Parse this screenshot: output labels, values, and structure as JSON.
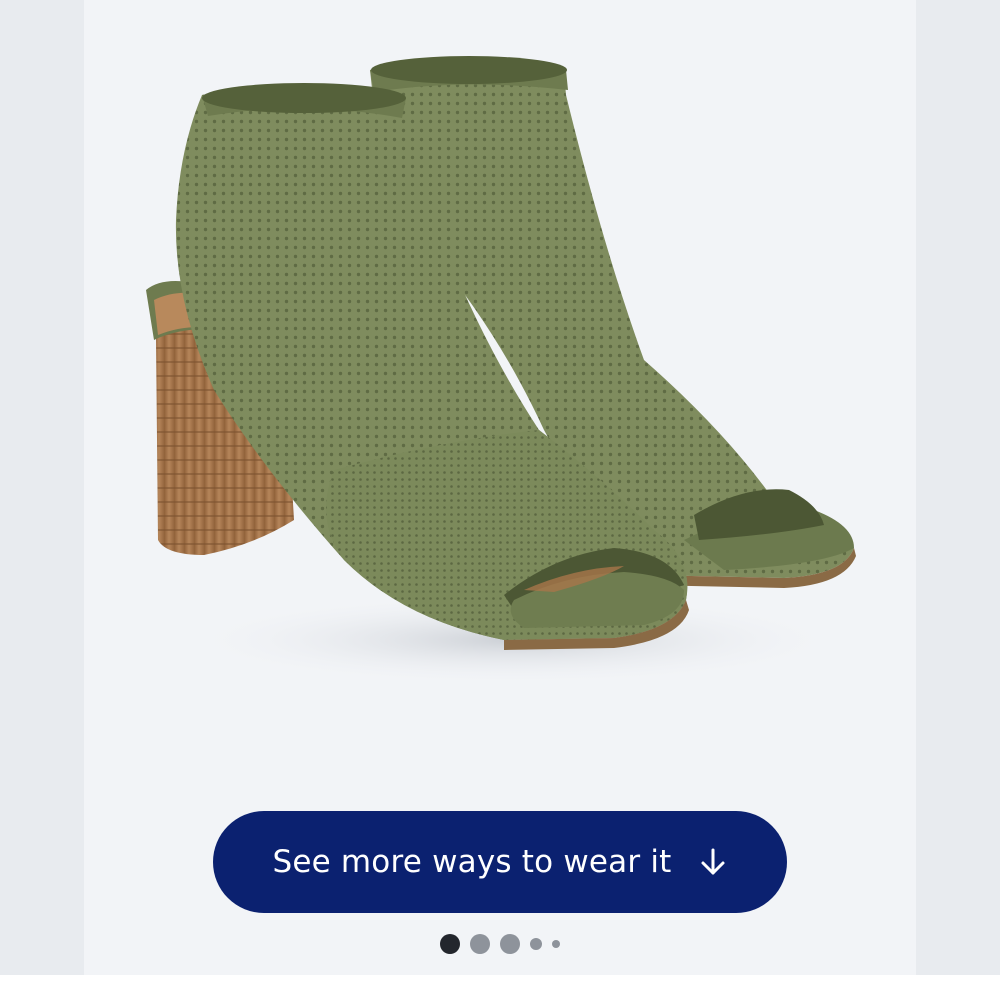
{
  "product": {
    "image_alt": "Olive green knit peep-toe bootie with stacked wood block heel",
    "colors": {
      "knit": "#7f8c5e",
      "knit_dark": "#6b7850",
      "heel": "#a7764a",
      "sole": "#8a6a45"
    }
  },
  "cta": {
    "label": "See more ways to wear it",
    "icon": "arrow-down-icon",
    "background": "#0b2170"
  },
  "carousel": {
    "active_index": 0,
    "total": 5
  }
}
